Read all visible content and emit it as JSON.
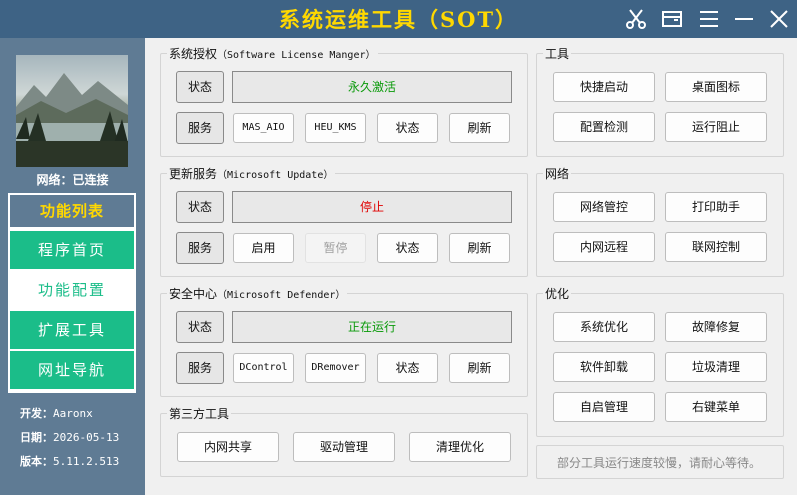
{
  "window": {
    "title": "系统运维工具（SOT）",
    "icons": [
      "scissors-icon",
      "window-icon",
      "menu-icon",
      "minimize-icon",
      "close-icon"
    ]
  },
  "sidebar": {
    "network_status": "网络：已连接",
    "nav_header": "功能列表",
    "nav_items": [
      "程序首页",
      "功能配置",
      "扩展工具",
      "网址导航"
    ],
    "active_item": "功能配置",
    "dev_label": "开发：",
    "dev_value": "Aaronx",
    "date_label": "日期：",
    "date_value": "2026-05-13",
    "version_label": "版本：",
    "version_value": "5.11.2.513"
  },
  "license": {
    "title_cn": "系统授权",
    "title_en": "（Software License Manger）",
    "status_label": "状态",
    "status_value": "永久激活",
    "service_label": "服务",
    "buttons": [
      "MAS_AIO",
      "HEU_KMS",
      "状态",
      "刷新"
    ]
  },
  "update": {
    "title_cn": "更新服务",
    "title_en": "（Microsoft Update）",
    "status_label": "状态",
    "status_value": "停止",
    "service_label": "服务",
    "buttons": [
      "启用",
      "暂停",
      "状态",
      "刷新"
    ]
  },
  "defender": {
    "title_cn": "安全中心",
    "title_en": "（Microsoft Defender）",
    "status_label": "状态",
    "status_value": "正在运行",
    "service_label": "服务",
    "buttons": [
      "DControl",
      "DRemover",
      "状态",
      "刷新"
    ]
  },
  "third_party": {
    "title": "第三方工具",
    "buttons": [
      "内网共享",
      "驱动管理",
      "清理优化"
    ]
  },
  "tools": {
    "title": "工具",
    "buttons": [
      "快捷启动",
      "桌面图标",
      "配置检测",
      "运行阻止"
    ]
  },
  "network": {
    "title": "网络",
    "buttons": [
      "网络管控",
      "打印助手",
      "内网远程",
      "联网控制"
    ]
  },
  "optimize": {
    "title": "优化",
    "buttons": [
      "系统优化",
      "故障修复",
      "软件卸载",
      "垃圾清理",
      "自启管理",
      "右键菜单"
    ]
  },
  "footer_note": "部分工具运行速度较慢，请耐心等待。",
  "colors": {
    "titlebar": "#3e6385",
    "title_text": "#ffd800",
    "sidebar": "#5f7b94",
    "nav_green": "#1bbd89",
    "status_green": "#0a9a0a",
    "status_red": "#e00000"
  }
}
